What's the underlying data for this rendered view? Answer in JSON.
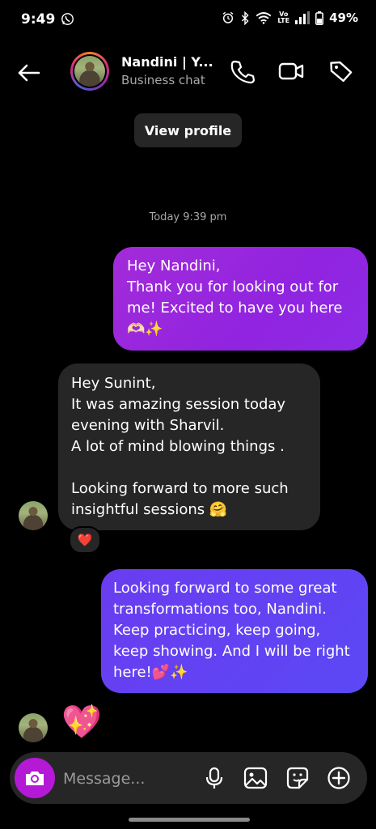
{
  "status_bar": {
    "time": "9:49",
    "lte_top": "Vo",
    "lte_bottom": "LTE",
    "battery": "49%"
  },
  "header": {
    "contact_name": "Nandini | Y...",
    "subtitle": "Business chat",
    "icons": [
      "back-arrow-icon",
      "phone-icon",
      "video-camera-icon",
      "tag-icon"
    ]
  },
  "view_profile_label": "View profile",
  "timestamp": "Today 9:39 pm",
  "messages": [
    {
      "direction": "outgoing",
      "text": "Hey Nandini,\nThank you for looking out for me! Excited to have you here 🫶🏻✨"
    },
    {
      "direction": "incoming",
      "text": "Hey Sunint,\nIt was amazing session today evening with Sharvil.\nA lot of mind blowing things .\n\nLooking forward to more such insightful sessions 🤗",
      "reaction": "❤️"
    },
    {
      "direction": "outgoing",
      "text": "Looking forward to some great transformations too, Nandini. Keep practicing, keep going, keep showing. And I will be right here!💕✨"
    },
    {
      "direction": "incoming",
      "sticker": "💖"
    }
  ],
  "composer": {
    "placeholder": "Message...",
    "icons": [
      "camera-icon",
      "microphone-icon",
      "gallery-icon",
      "sticker-icon",
      "add-icon"
    ]
  },
  "colors": {
    "background": "#000000",
    "outgoing_bubble_1": "#9c27dc",
    "outgoing_bubble_2": "#5e44f3",
    "incoming_bubble": "#262626",
    "camera_button": "#b41ad6"
  }
}
